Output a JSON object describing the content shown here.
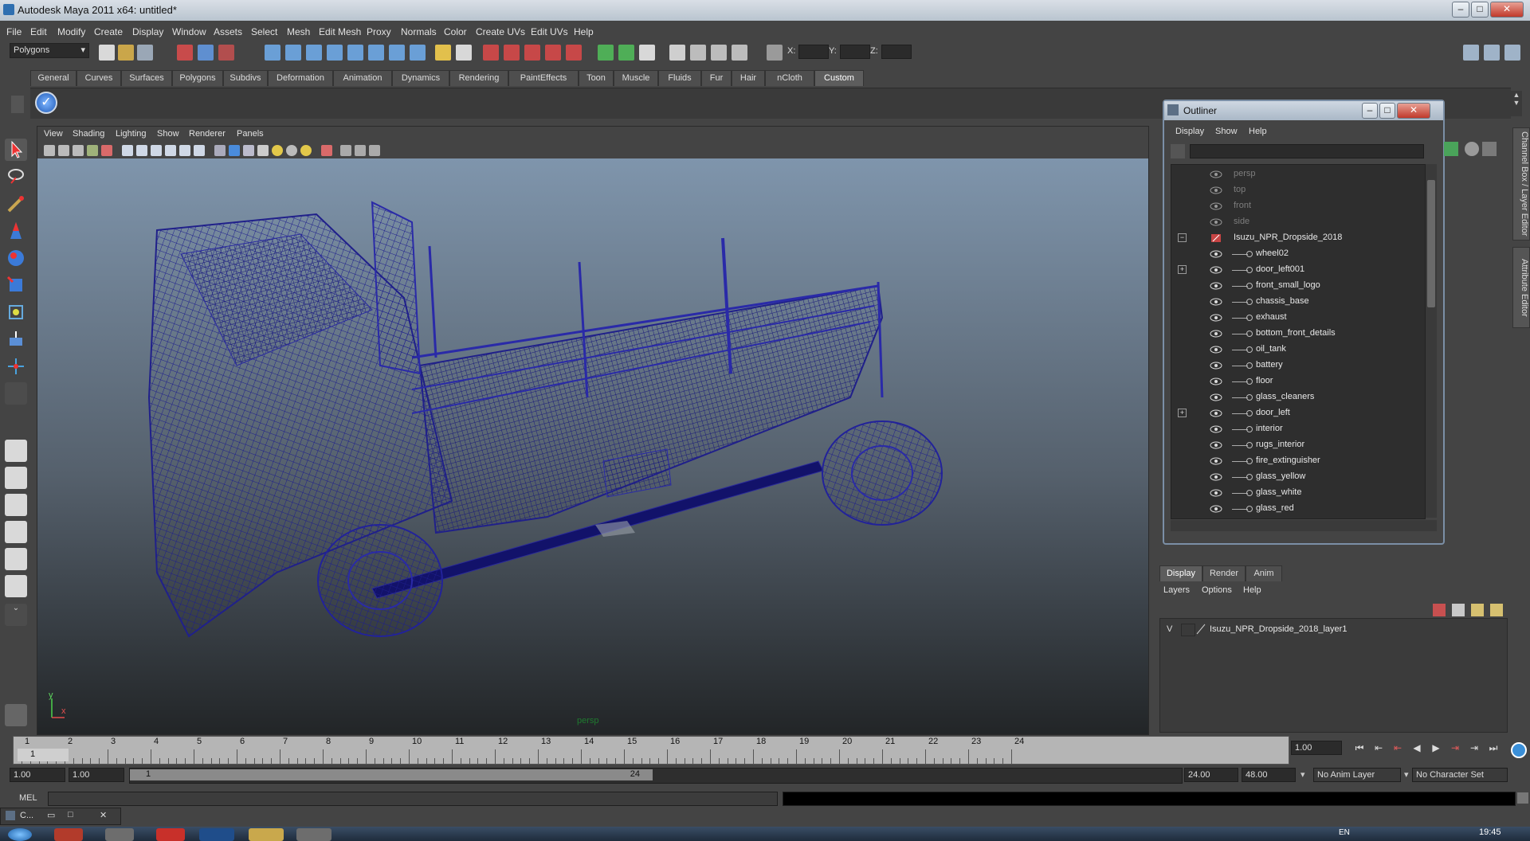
{
  "window": {
    "title": "Autodesk Maya 2011 x64: untitled*"
  },
  "menubar": {
    "items": [
      "File",
      "Edit",
      "Modify",
      "Create",
      "Display",
      "Window",
      "Assets",
      "Select",
      "Mesh",
      "Edit Mesh",
      "Proxy",
      "Normals",
      "Color",
      "Create UVs",
      "Edit UVs",
      "Help"
    ]
  },
  "statusline": {
    "mode": "Polygons",
    "x_label": "X:",
    "y_label": "Y:",
    "z_label": "Z:"
  },
  "shelf": {
    "tabs": [
      "General",
      "Curves",
      "Surfaces",
      "Polygons",
      "Subdivs",
      "Deformation",
      "Animation",
      "Dynamics",
      "Rendering",
      "PaintEffects",
      "Toon",
      "Muscle",
      "Fluids",
      "Fur",
      "Hair",
      "nCloth",
      "Custom"
    ],
    "active_tab": "Custom"
  },
  "viewport": {
    "menus": [
      "View",
      "Shading",
      "Lighting",
      "Show",
      "Renderer",
      "Panels"
    ],
    "camera_label": "persp",
    "axis_y": "y",
    "axis_x": "x",
    "wire_color": "#1a1a7a"
  },
  "outliner": {
    "title": "Outliner",
    "menus": [
      "Display",
      "Show",
      "Help"
    ],
    "items": [
      {
        "label": "persp",
        "type": "camera",
        "indent": 0,
        "expand": ""
      },
      {
        "label": "top",
        "type": "camera",
        "indent": 0,
        "expand": ""
      },
      {
        "label": "front",
        "type": "camera",
        "indent": 0,
        "expand": ""
      },
      {
        "label": "side",
        "type": "camera",
        "indent": 0,
        "expand": ""
      },
      {
        "label": "Isuzu_NPR_Dropside_2018",
        "type": "group",
        "indent": 0,
        "expand": "−"
      },
      {
        "label": "wheel02",
        "type": "mesh",
        "indent": 1,
        "expand": ""
      },
      {
        "label": "door_left001",
        "type": "mesh",
        "indent": 1,
        "expand": "+"
      },
      {
        "label": "front_small_logo",
        "type": "mesh",
        "indent": 1,
        "expand": ""
      },
      {
        "label": "chassis_base",
        "type": "mesh",
        "indent": 1,
        "expand": ""
      },
      {
        "label": "exhaust",
        "type": "mesh",
        "indent": 1,
        "expand": ""
      },
      {
        "label": "bottom_front_details",
        "type": "mesh",
        "indent": 1,
        "expand": ""
      },
      {
        "label": "oil_tank",
        "type": "mesh",
        "indent": 1,
        "expand": ""
      },
      {
        "label": "battery",
        "type": "mesh",
        "indent": 1,
        "expand": ""
      },
      {
        "label": "floor",
        "type": "mesh",
        "indent": 1,
        "expand": ""
      },
      {
        "label": "glass_cleaners",
        "type": "mesh",
        "indent": 1,
        "expand": ""
      },
      {
        "label": "door_left",
        "type": "mesh",
        "indent": 1,
        "expand": "+"
      },
      {
        "label": "interior",
        "type": "mesh",
        "indent": 1,
        "expand": ""
      },
      {
        "label": "rugs_interior",
        "type": "mesh",
        "indent": 1,
        "expand": ""
      },
      {
        "label": "fire_extinguisher",
        "type": "mesh",
        "indent": 1,
        "expand": ""
      },
      {
        "label": "glass_yellow",
        "type": "mesh",
        "indent": 1,
        "expand": ""
      },
      {
        "label": "glass_white",
        "type": "mesh",
        "indent": 1,
        "expand": ""
      },
      {
        "label": "glass_red",
        "type": "mesh",
        "indent": 1,
        "expand": ""
      }
    ]
  },
  "side_tabs": {
    "channel_box": "Channel Box / Layer Editor",
    "attribute_editor": "Attribute Editor"
  },
  "layer_editor": {
    "tabs": [
      "Display",
      "Render",
      "Anim"
    ],
    "active_tab": "Display",
    "menus": [
      "Layers",
      "Options",
      "Help"
    ],
    "layers": [
      {
        "visible": "V",
        "name": "Isuzu_NPR_Dropside_2018_layer1"
      }
    ]
  },
  "timeline": {
    "ticks": [
      "1",
      "2",
      "3",
      "4",
      "5",
      "6",
      "7",
      "8",
      "9",
      "10",
      "11",
      "12",
      "13",
      "14",
      "15",
      "16",
      "17",
      "18",
      "19",
      "20",
      "21",
      "22",
      "23",
      "24"
    ],
    "current_frame_marker": "1",
    "current_time": "1.00"
  },
  "range": {
    "start_time": "1.00",
    "playback_start": "1.00",
    "slider_start": "1",
    "slider_end": "24",
    "playback_end": "24.00",
    "end_time": "48.00",
    "anim_layer": "No Anim Layer",
    "character_set": "No Character Set"
  },
  "commandline": {
    "label": "MEL"
  },
  "minimized_window": {
    "label": "C..."
  },
  "taskbar": {
    "clock": "19:45",
    "lang": "EN"
  }
}
